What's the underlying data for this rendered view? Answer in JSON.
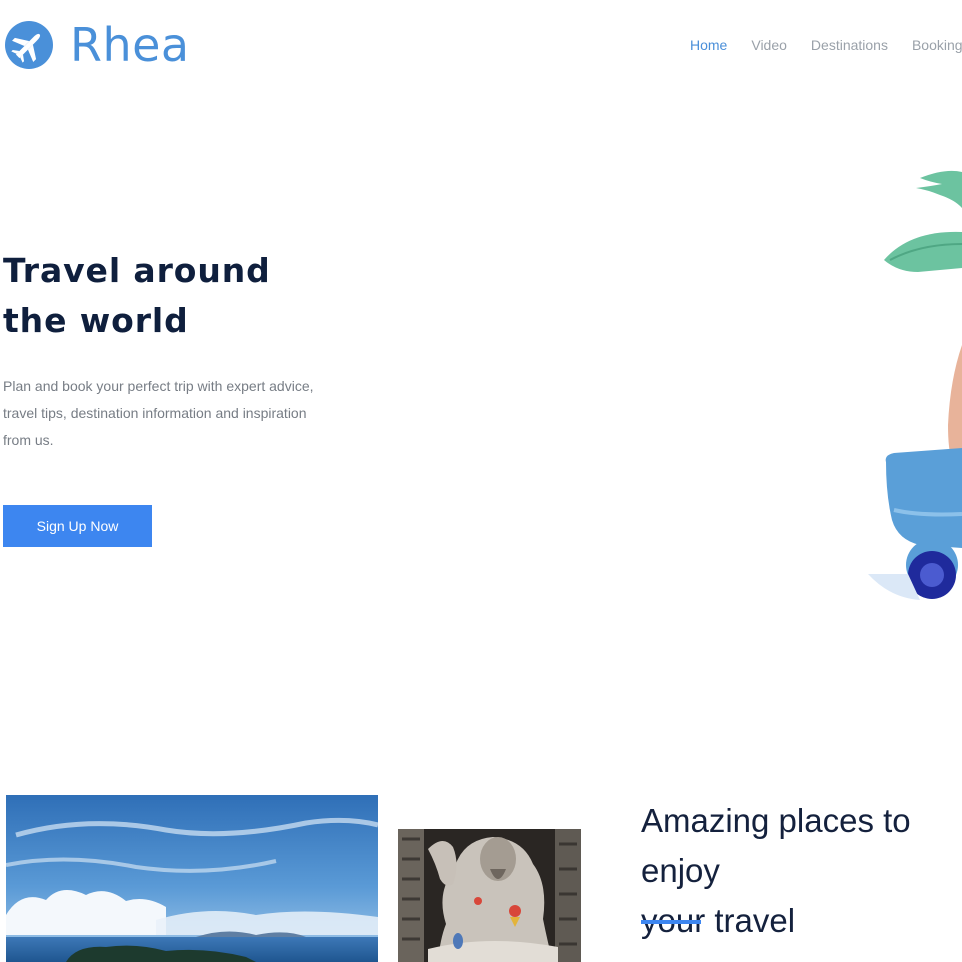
{
  "brand": {
    "name": "Rhea",
    "icon": "airplane-icon",
    "color": "#4a90d9"
  },
  "nav": {
    "items": [
      {
        "label": "Home",
        "active": true
      },
      {
        "label": "Video",
        "active": false
      },
      {
        "label": "Destinations",
        "active": false
      },
      {
        "label": "Booking",
        "active": false
      }
    ]
  },
  "hero": {
    "title_line1": "Travel around",
    "title_line2": "the world",
    "description": "Plan and book your perfect trip with expert advice, travel tips, destination information and inspiration from us.",
    "cta_label": "Sign Up Now",
    "cta_color": "#3d86f0"
  },
  "section": {
    "title_line1": "Amazing places to enjoy",
    "title_line2": "your travel",
    "accent_color": "#3d86f0"
  }
}
